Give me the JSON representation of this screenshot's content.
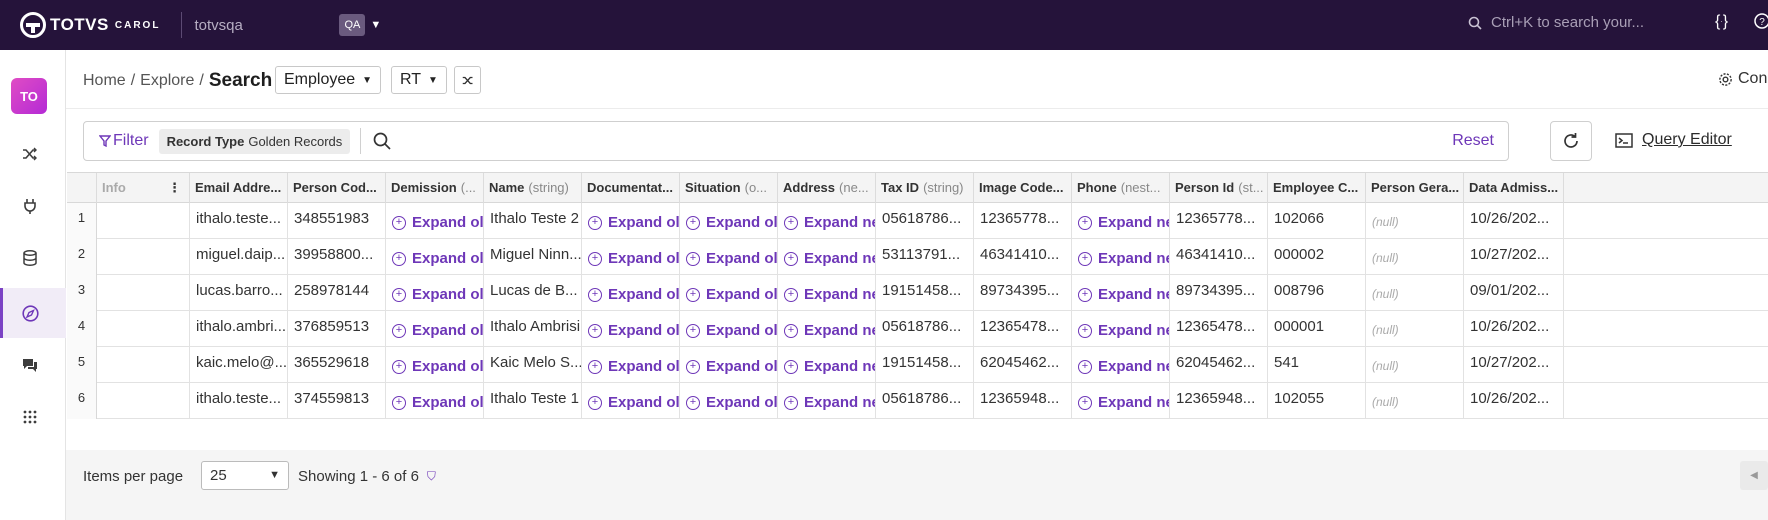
{
  "topbar": {
    "brand": "TOTVS",
    "brand_sub": "CAROL",
    "tenant": "totvsqa",
    "env": "QA",
    "search_placeholder": "Ctrl+K to search your..."
  },
  "sidebar": {
    "avatar": "TO",
    "icons": [
      "shuffle-icon",
      "plug-icon",
      "database-icon",
      "compass-icon",
      "chat-icon",
      "apps-grid-icon"
    ]
  },
  "breadcrumb": {
    "home": "Home",
    "explore": "Explore",
    "current": "Search"
  },
  "entity_select": "Employee",
  "mode_select": "RT",
  "config_link": "Con",
  "filter": {
    "label": "Filter",
    "chip_key": "Record Type",
    "chip_value": "Golden Records",
    "reset": "Reset"
  },
  "query_editor": "Query Editor",
  "table": {
    "headers": [
      {
        "name": "Info",
        "type": ""
      },
      {
        "name": "Email Addre...",
        "type": ""
      },
      {
        "name": "Person Cod...",
        "type": ""
      },
      {
        "name": "Demission",
        "type": "(..."
      },
      {
        "name": "Name",
        "type": "(string)"
      },
      {
        "name": "Documentat...",
        "type": ""
      },
      {
        "name": "Situation",
        "type": "(o..."
      },
      {
        "name": "Address",
        "type": "(ne..."
      },
      {
        "name": "Tax ID",
        "type": "(string)"
      },
      {
        "name": "Image Code...",
        "type": ""
      },
      {
        "name": "Phone",
        "type": "(nest..."
      },
      {
        "name": "Person Id",
        "type": "(st..."
      },
      {
        "name": "Employee C...",
        "type": ""
      },
      {
        "name": "Person Gera...",
        "type": ""
      },
      {
        "name": "Data Admiss...",
        "type": ""
      }
    ],
    "expand_label": "Expand ol",
    "expand_label_nested": "Expand ne",
    "null_label": "(null)",
    "rows": [
      {
        "n": "1",
        "email": "ithalo.teste...",
        "code": "348551983",
        "name": "Ithalo Teste 2",
        "tax": "05618786...",
        "image": "12365778...",
        "pid": "12365778...",
        "emp": "102066",
        "adm": "10/26/202..."
      },
      {
        "n": "2",
        "email": "miguel.daip...",
        "code": "39958800...",
        "name": "Miguel Ninn...",
        "tax": "53113791...",
        "image": "46341410...",
        "pid": "46341410...",
        "emp": "000002",
        "adm": "10/27/202..."
      },
      {
        "n": "3",
        "email": "lucas.barro...",
        "code": "258978144",
        "name": "Lucas de B...",
        "tax": "19151458...",
        "image": "89734395...",
        "pid": "89734395...",
        "emp": "008796",
        "adm": "09/01/202..."
      },
      {
        "n": "4",
        "email": "ithalo.ambri...",
        "code": "376859513",
        "name": "Ithalo Ambrisi",
        "tax": "05618786...",
        "image": "12365478...",
        "pid": "12365478...",
        "emp": "000001",
        "adm": "10/26/202..."
      },
      {
        "n": "5",
        "email": "kaic.melo@...",
        "code": "365529618",
        "name": "Kaic Melo S...",
        "tax": "19151458...",
        "image": "62045462...",
        "pid": "62045462...",
        "emp": "541",
        "adm": "10/27/202..."
      },
      {
        "n": "6",
        "email": "ithalo.teste...",
        "code": "374559813",
        "name": "Ithalo Teste 1",
        "tax": "05618786...",
        "image": "12365948...",
        "pid": "12365948...",
        "emp": "102055",
        "adm": "10/26/202..."
      }
    ]
  },
  "footer": {
    "items_per_page_label": "Items per page",
    "page_size": "25",
    "showing": "Showing 1 - 6 of 6"
  },
  "colors": {
    "topbar_bg": "#25133a",
    "accent": "#6e37b8"
  }
}
